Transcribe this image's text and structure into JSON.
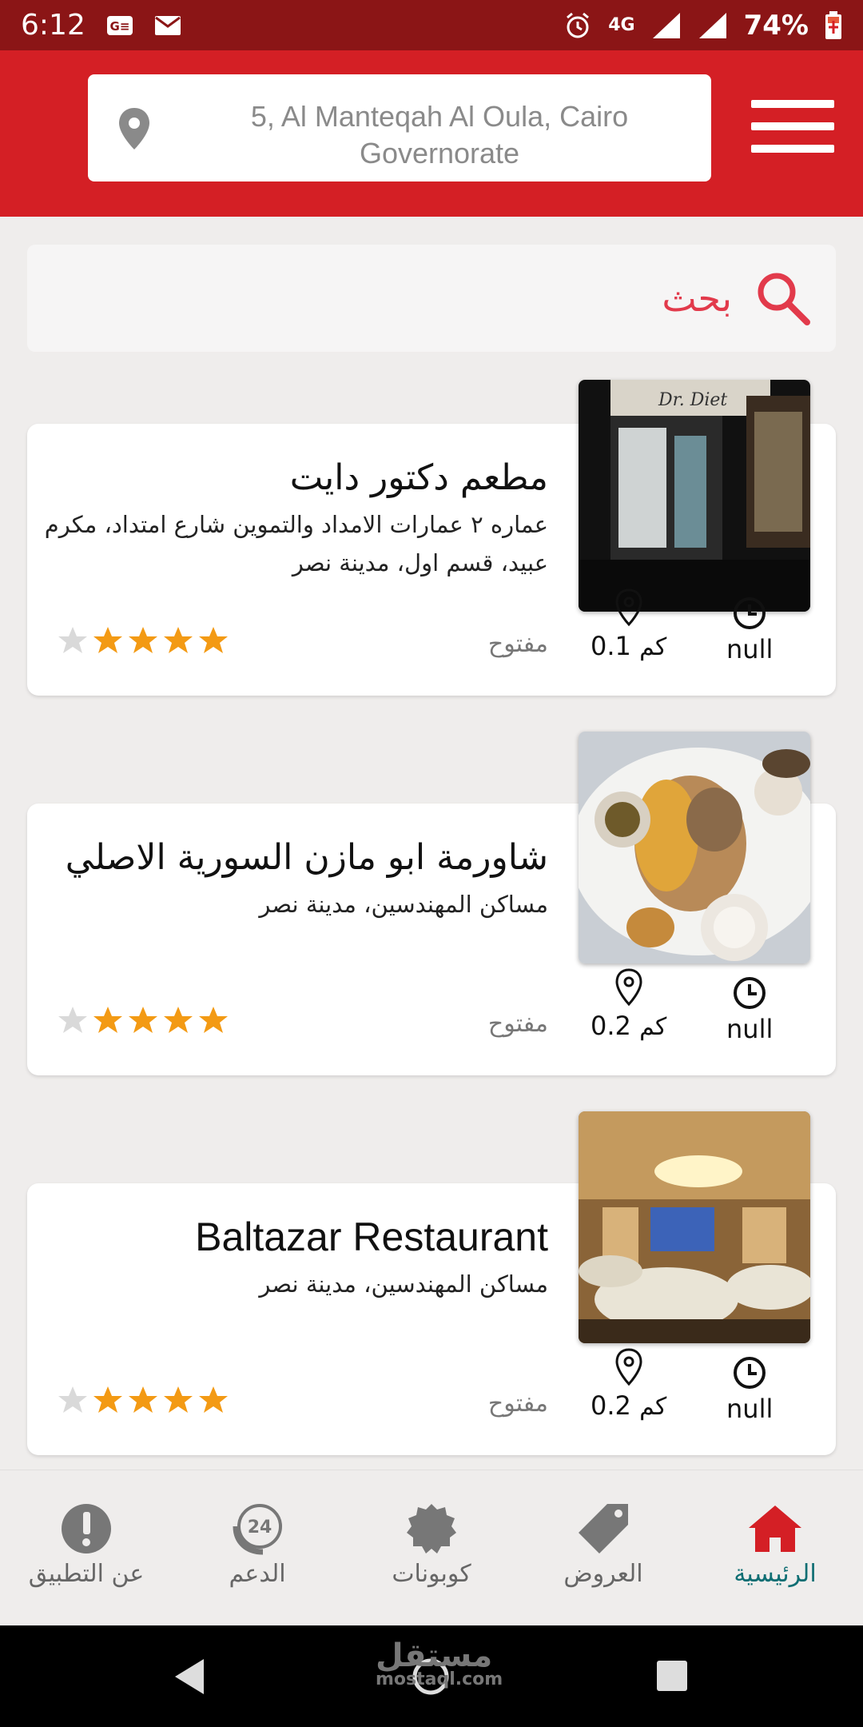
{
  "status_bar": {
    "time": "6:12",
    "network": "4G",
    "battery": "74%"
  },
  "header": {
    "location_text": "5, Al Manteqah Al Oula, Cairo Governorate"
  },
  "search": {
    "label": "بحث"
  },
  "restaurants": [
    {
      "name": "مطعم دكتور دايت",
      "address": "عماره ٢ عمارات الامداد والتموين شارع امتداد، مكرم عبيد، قسم اول، مدينة نصر",
      "status": "مفتوح",
      "distance": "0.1",
      "distance_unit": "كم",
      "hours": "null",
      "rating": 4,
      "max_rating": 5
    },
    {
      "name": "شاورمة ابو مازن السورية الاصلي",
      "address": "مساكن المهندسين، مدينة نصر",
      "status": "مفتوح",
      "distance": "0.2",
      "distance_unit": "كم",
      "hours": "null",
      "rating": 4,
      "max_rating": 5
    },
    {
      "name": "Baltazar Restaurant",
      "address": "مساكن المهندسين، مدينة نصر",
      "status": "مفتوح",
      "distance": "0.2",
      "distance_unit": "كم",
      "hours": "null",
      "rating": 4,
      "max_rating": 5
    }
  ],
  "bottom_nav": [
    {
      "label": "عن التطبيق",
      "icon": "info-icon"
    },
    {
      "label": "الدعم",
      "icon": "support-24-icon"
    },
    {
      "label": "كوبونات",
      "icon": "coupon-icon"
    },
    {
      "label": "العروض",
      "icon": "tag-icon"
    },
    {
      "label": "الرئيسية",
      "icon": "home-icon",
      "active": true
    }
  ],
  "watermark": {
    "text": "مستقل",
    "sub": "mostaql.com"
  },
  "colors": {
    "primary": "#d41f25",
    "status_bar": "#8b1516",
    "star": "#f39a14",
    "active_nav": "#0f6e73",
    "search_accent": "#e23a4b"
  }
}
